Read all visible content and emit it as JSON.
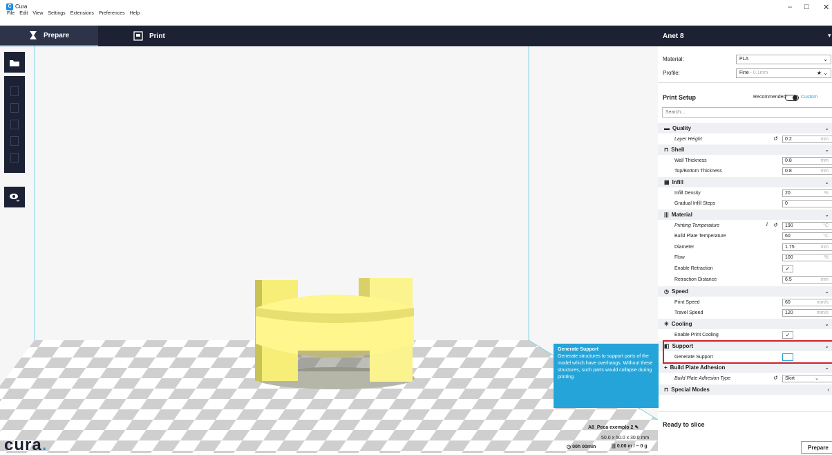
{
  "window": {
    "title": "Cura",
    "minimize": "–",
    "maximize": "□",
    "close": "✕"
  },
  "menu": [
    "File",
    "Edit",
    "View",
    "Settings",
    "Extensions",
    "Preferences",
    "Help"
  ],
  "tabs": {
    "prepare": "Prepare",
    "print": "Print"
  },
  "printer": {
    "name": "Anet 8"
  },
  "material": {
    "label": "Material:",
    "value": "PLA"
  },
  "profile": {
    "label": "Profile:",
    "value": "Fine",
    "hint": "- 0.1mm"
  },
  "setup": {
    "title": "Print Setup",
    "recommended": "Recommended",
    "custom": "Custom",
    "search_placeholder": "Search..."
  },
  "settings": {
    "quality": "Quality",
    "layer_height": {
      "label": "Layer Height",
      "value": "0.2",
      "unit": "mm"
    },
    "shell": "Shell",
    "wall_thickness": {
      "label": "Wall Thickness",
      "value": "0.8",
      "unit": "mm"
    },
    "topbottom": {
      "label": "Top/Bottom Thickness",
      "value": "0.8",
      "unit": "mm"
    },
    "infill": "Infill",
    "infill_density": {
      "label": "Infill Density",
      "value": "20",
      "unit": "%"
    },
    "gradual_infill": {
      "label": "Gradual Infill Steps",
      "value": "0"
    },
    "material_cat": "Material",
    "print_temp": {
      "label": "Printing Temperature",
      "value": "190",
      "unit": "°C"
    },
    "plate_temp": {
      "label": "Build Plate Temperature",
      "value": "60",
      "unit": "°C"
    },
    "diameter": {
      "label": "Diameter",
      "value": "1.75",
      "unit": "mm"
    },
    "flow": {
      "label": "Flow",
      "value": "100",
      "unit": "%"
    },
    "enable_retraction": {
      "label": "Enable Retraction",
      "checked": "✓"
    },
    "retraction_distance": {
      "label": "Retraction Distance",
      "value": "6.5",
      "unit": "mm"
    },
    "speed": "Speed",
    "print_speed": {
      "label": "Print Speed",
      "value": "60",
      "unit": "mm/s"
    },
    "travel_speed": {
      "label": "Travel Speed",
      "value": "120",
      "unit": "mm/s"
    },
    "cooling": "Cooling",
    "enable_cooling": {
      "label": "Enable Print Cooling",
      "checked": "✓"
    },
    "support": "Support",
    "generate_support": {
      "label": "Generate Support",
      "checked": ""
    },
    "adhesion": "Build Plate Adhesion",
    "adhesion_type": {
      "label": "Build Plate Adhesion Type",
      "value": "Skirt"
    },
    "special": "Special Modes"
  },
  "tooltip": {
    "title": "Generate Support",
    "body": "Generate structures to support parts of the model which have overhangs. Without these structures, such parts would collapse during printing."
  },
  "status": {
    "ready": "Ready to slice",
    "prepare_button": "Prepare"
  },
  "object": {
    "name": "A8_Peca exemplo 2",
    "size": "50.0 x 50.0 x 30.0 mm",
    "time": "00h 00min",
    "usage": "0.00 m / ~ 0 g"
  },
  "logo": {
    "text": "cura",
    "dot": "."
  }
}
